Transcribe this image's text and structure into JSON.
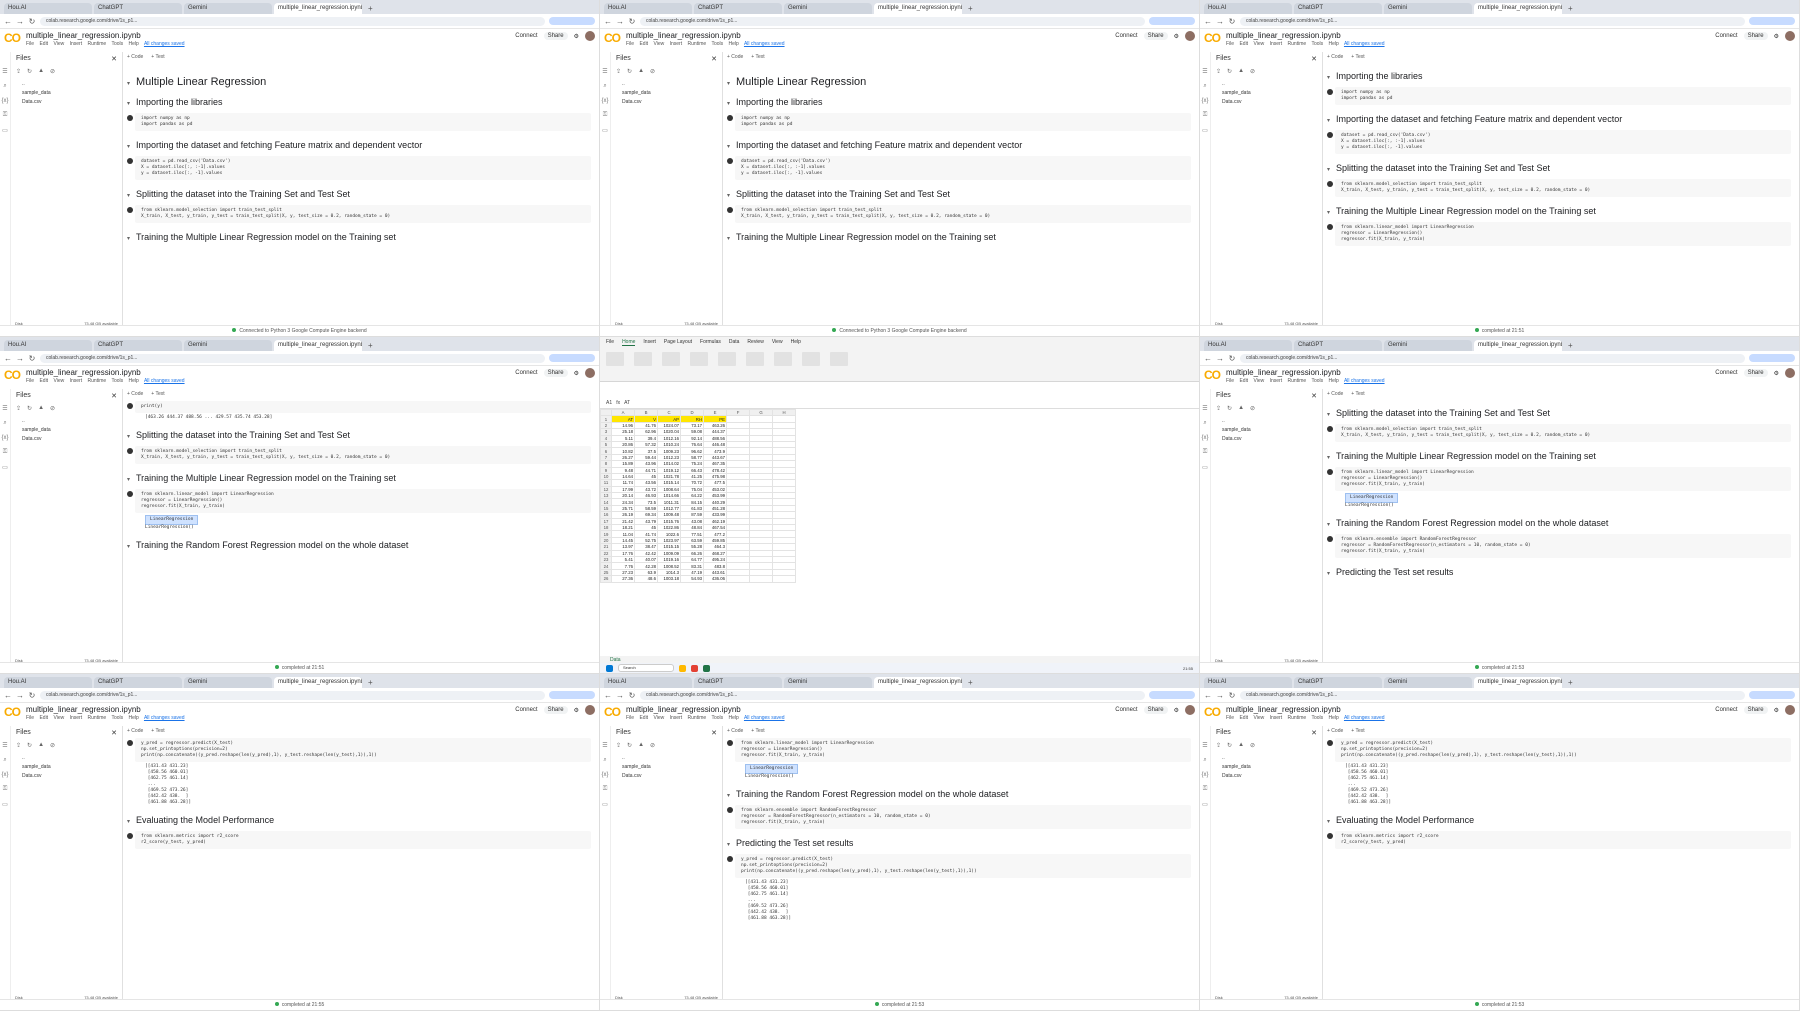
{
  "tabs": [
    "Hou.AI",
    "ChatGPT",
    "Gemini",
    "multiple_linear_regression.ipynb"
  ],
  "new_tab": "+",
  "url": "colab.research.google.com/drive/1s_p1...",
  "notebook": {
    "logo": "CO",
    "title": "multiple_linear_regression.ipynb",
    "menu": [
      "File",
      "Edit",
      "View",
      "Insert",
      "Runtime",
      "Tools",
      "Help"
    ],
    "changes_link": "All changes saved",
    "connect": "Connect",
    "share": "Share",
    "code_btn": "+ Code",
    "text_btn": "+ Text"
  },
  "files_panel": {
    "title": "Files",
    "items": [
      "..",
      "sample_data",
      "Data.csv"
    ],
    "disk": "Disk",
    "disk_avail": "73.48 GB available"
  },
  "sections": {
    "title": "Multiple Linear Regression",
    "libs": "Importing the libraries",
    "dataset": "Importing the dataset and fetching Feature matrix and dependent vector",
    "split": "Splitting the dataset into the Training Set and Test Set",
    "train": "Training the Multiple Linear Regression model on the Training set",
    "forest": "Training the Random Forest Regression model on the whole dataset",
    "predict": "Predicting the Test set results",
    "evaluate": "Evaluating the Model Performance"
  },
  "code": {
    "libs": "import numpy as np\nimport pandas as pd",
    "dataset": "dataset = pd.read_csv('Data.csv')\nX = dataset.iloc[:, :-1].values\ny = dataset.iloc[:, -1].values",
    "split": "from sklearn.model_selection import train_test_split\nX_train, X_test, y_train, y_test = train_test_split(X, y, test_size = 0.2, random_state = 0)",
    "train": "from sklearn.linear_model import LinearRegression\nregressor = LinearRegression()\nregressor.fit(X_train, y_train)",
    "forest": "from sklearn.ensemble import RandomForestRegressor\nregressor = RandomForestRegressor(n_estimators = 10, random_state = 0)\nregressor.fit(X_train, y_train)",
    "predict": "y_pred = regressor.predict(X_test)\nnp.set_printoptions(precision=2)\nprint(np.concatenate((y_pred.reshape(len(y_pred),1), y_test.reshape(len(y_test),1)),1))",
    "evaluate": "from sklearn.metrics import r2_score\nr2_score(y_test, y_pred)",
    "print": "print(y)"
  },
  "outputs": {
    "model": "LinearRegression",
    "model_call": "LinearRegression()",
    "predict": "[[431.43 431.23]\n [458.56 460.01]\n [462.75 461.14]\n ...\n [469.52 473.26]\n [442.42 438.  ]\n [461.88 463.28]]",
    "y_vec": "[463.26 444.37 488.56 ... 429.57 435.74 453.28]"
  },
  "status": {
    "connected": "Connected to Python 3 Google Compute Engine backend",
    "completed1": "completed at 21:51",
    "completed2": "completed at 21:53",
    "completed3": "completed at 21:55"
  },
  "taskbar": {
    "search": "Search",
    "weather": "24°C Haze",
    "time": "21:55"
  },
  "excel": {
    "title": "Data",
    "tabs": [
      "File",
      "Home",
      "Insert",
      "Page Layout",
      "Formulas",
      "Data",
      "Review",
      "View",
      "Help"
    ],
    "cell_ref": "A1",
    "formula": "AT",
    "sheet": "Data",
    "status": "Ready",
    "cols": [
      "A",
      "B",
      "C",
      "D",
      "E",
      "F",
      "G",
      "H"
    ],
    "header": [
      "AT",
      "V",
      "AP",
      "RH",
      "PE"
    ],
    "rows": [
      [
        "14.96",
        "41.76",
        "1024.07",
        "73.17",
        "463.26"
      ],
      [
        "25.18",
        "62.96",
        "1020.04",
        "59.08",
        "444.37"
      ],
      [
        "5.11",
        "39.4",
        "1012.16",
        "92.14",
        "488.56"
      ],
      [
        "20.86",
        "57.32",
        "1010.24",
        "76.64",
        "446.48"
      ],
      [
        "10.82",
        "37.5",
        "1009.23",
        "96.62",
        "473.9"
      ],
      [
        "26.27",
        "59.44",
        "1012.23",
        "58.77",
        "443.67"
      ],
      [
        "15.89",
        "43.96",
        "1014.02",
        "75.24",
        "467.35"
      ],
      [
        "9.48",
        "44.71",
        "1019.12",
        "66.43",
        "478.42"
      ],
      [
        "14.64",
        "45",
        "1021.78",
        "41.25",
        "475.98"
      ],
      [
        "11.74",
        "43.56",
        "1015.14",
        "70.72",
        "477.5"
      ],
      [
        "17.99",
        "43.72",
        "1008.64",
        "75.04",
        "453.02"
      ],
      [
        "20.14",
        "46.93",
        "1014.66",
        "64.22",
        "453.99"
      ],
      [
        "24.34",
        "73.5",
        "1011.31",
        "84.15",
        "440.29"
      ],
      [
        "25.71",
        "58.59",
        "1012.77",
        "61.83",
        "451.28"
      ],
      [
        "26.19",
        "69.34",
        "1009.48",
        "87.59",
        "433.99"
      ],
      [
        "21.42",
        "43.79",
        "1015.76",
        "43.08",
        "462.19"
      ],
      [
        "18.21",
        "45",
        "1022.86",
        "48.84",
        "467.54"
      ],
      [
        "11.04",
        "41.74",
        "1022.6",
        "77.51",
        "477.2"
      ],
      [
        "14.45",
        "52.75",
        "1023.97",
        "63.59",
        "459.85"
      ],
      [
        "13.97",
        "38.47",
        "1015.15",
        "55.28",
        "464.3"
      ],
      [
        "17.76",
        "42.42",
        "1009.09",
        "66.26",
        "468.27"
      ],
      [
        "5.41",
        "40.07",
        "1019.16",
        "64.77",
        "495.24"
      ],
      [
        "7.76",
        "42.28",
        "1008.52",
        "83.31",
        "483.8"
      ],
      [
        "27.23",
        "63.9",
        "1014.3",
        "47.19",
        "443.61"
      ],
      [
        "27.36",
        "48.6",
        "1003.18",
        "54.93",
        "436.06"
      ]
    ]
  }
}
